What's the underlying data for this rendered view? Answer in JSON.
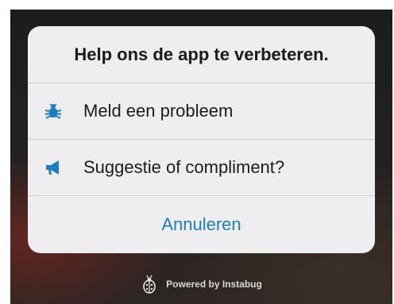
{
  "sheet": {
    "title": "Help ons de app te verbeteren.",
    "actions": [
      {
        "label": "Meld een probleem",
        "icon": "bug-icon"
      },
      {
        "label": "Suggestie of compliment?",
        "icon": "megaphone-icon"
      }
    ],
    "cancel_label": "Annuleren"
  },
  "footer": {
    "powered_by": "Powered by Instabug",
    "icon": "ladybug-logo-icon"
  },
  "colors": {
    "accent": "#1d7fbf",
    "sheet_background": "#eeeef0"
  }
}
